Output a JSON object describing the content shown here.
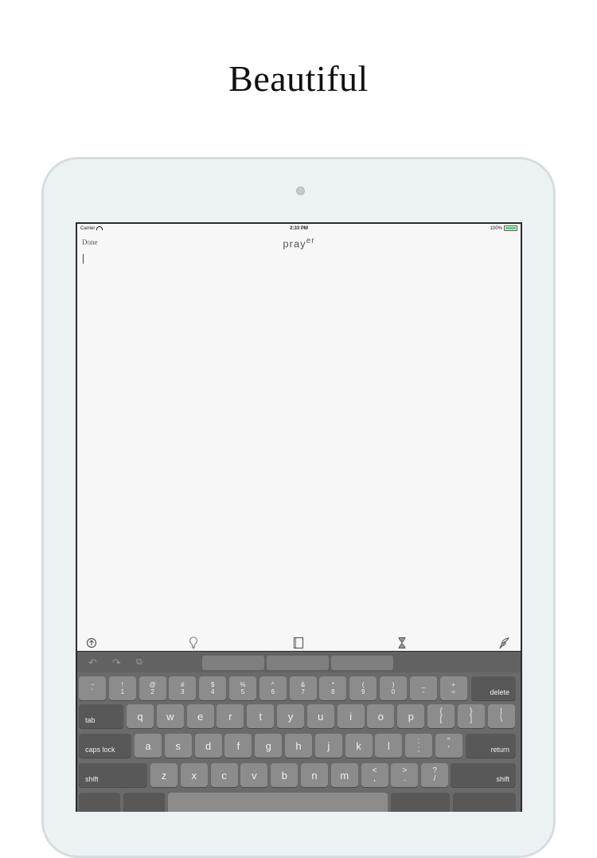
{
  "headline": "Beautiful",
  "status": {
    "carrier": "Carrier",
    "time": "2:33 PM",
    "battery": "100%"
  },
  "nav": {
    "done": "Done",
    "title_main": "pray",
    "title_super": "er"
  },
  "toolbar": {
    "icons": [
      "add-circle-icon",
      "lightbulb-icon",
      "book-icon",
      "hourglass-icon",
      "quill-pen-icon"
    ]
  },
  "keyboard": {
    "top_icons": [
      "undo-icon",
      "redo-icon",
      "paste-icon"
    ],
    "row_num": [
      {
        "top": "~",
        "bottom": "`"
      },
      {
        "top": "!",
        "bottom": "1"
      },
      {
        "top": "@",
        "bottom": "2"
      },
      {
        "top": "#",
        "bottom": "3"
      },
      {
        "top": "$",
        "bottom": "4"
      },
      {
        "top": "%",
        "bottom": "5"
      },
      {
        "top": "^",
        "bottom": "6"
      },
      {
        "top": "&",
        "bottom": "7"
      },
      {
        "top": "*",
        "bottom": "8"
      },
      {
        "top": "(",
        "bottom": "9"
      },
      {
        "top": ")",
        "bottom": "0"
      },
      {
        "top": "_",
        "bottom": "-"
      },
      {
        "top": "+",
        "bottom": "="
      }
    ],
    "delete": "delete",
    "tab": "tab",
    "row_q": [
      "q",
      "w",
      "e",
      "r",
      "t",
      "y",
      "u",
      "i",
      "o",
      "p"
    ],
    "row_q_extra": [
      {
        "top": "{",
        "bottom": "["
      },
      {
        "top": "}",
        "bottom": "]"
      },
      {
        "top": "|",
        "bottom": "\\"
      }
    ],
    "caps_lock": "caps lock",
    "row_a": [
      "a",
      "s",
      "d",
      "f",
      "g",
      "h",
      "j",
      "k",
      "l"
    ],
    "row_a_extra": [
      {
        "top": ":",
        "bottom": ";"
      },
      {
        "top": "\"",
        "bottom": "'"
      }
    ],
    "return": "return",
    "shift": "shift",
    "row_z": [
      "z",
      "x",
      "c",
      "v",
      "b",
      "n",
      "m"
    ],
    "row_z_extra": [
      {
        "top": "<",
        "bottom": ","
      },
      {
        "top": ">",
        "bottom": "."
      },
      {
        "top": "?",
        "bottom": "/"
      }
    ]
  }
}
